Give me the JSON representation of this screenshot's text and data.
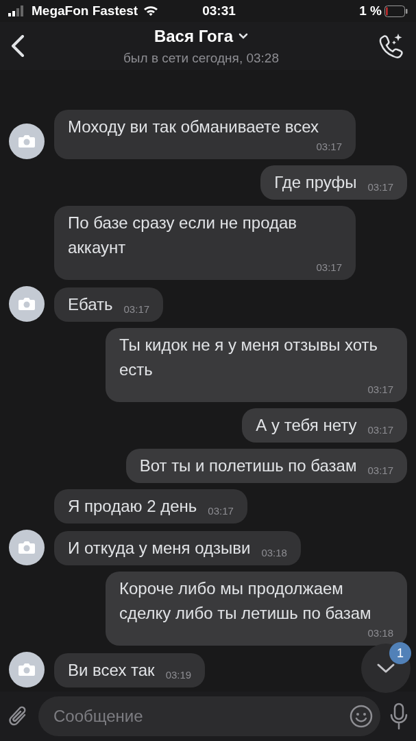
{
  "status_bar": {
    "carrier": "MegaFon Fastest",
    "time": "03:31",
    "battery": "1 %"
  },
  "header": {
    "title": "Вася Гога",
    "subtitle": "был в сети сегодня, 03:28"
  },
  "messages": [
    {
      "outgoing": false,
      "avatar": true,
      "text": "Моходу ви так обманиваете всех",
      "time": "03:17"
    },
    {
      "outgoing": true,
      "avatar": false,
      "text": "Где пруфы",
      "time": "03:17"
    },
    {
      "outgoing": false,
      "avatar": false,
      "text": "По базе сразу если не продав аккаунт",
      "time": "03:17"
    },
    {
      "outgoing": false,
      "avatar": true,
      "text": "Ебать",
      "time": "03:17"
    },
    {
      "outgoing": true,
      "avatar": false,
      "text": "Ты кидок не я у меня отзывы хоть есть",
      "time": "03:17"
    },
    {
      "outgoing": true,
      "avatar": false,
      "text": "А у тебя нету",
      "time": "03:17"
    },
    {
      "outgoing": true,
      "avatar": false,
      "text": "Вот ты и полетишь по базам",
      "time": "03:17"
    },
    {
      "outgoing": false,
      "avatar": false,
      "text": "Я продаю 2 день",
      "time": "03:17"
    },
    {
      "outgoing": false,
      "avatar": true,
      "text": "И откуда у меня одзыви",
      "time": "03:18"
    },
    {
      "outgoing": true,
      "avatar": false,
      "text": "Короче либо мы продолжаем сделку либо ты летишь по базам",
      "time": "03:18"
    },
    {
      "outgoing": false,
      "avatar": true,
      "text": "Ви всех так",
      "time": "03:19"
    }
  ],
  "scroll_button": {
    "badge": "1"
  },
  "composer": {
    "placeholder": "Сообщение"
  }
}
